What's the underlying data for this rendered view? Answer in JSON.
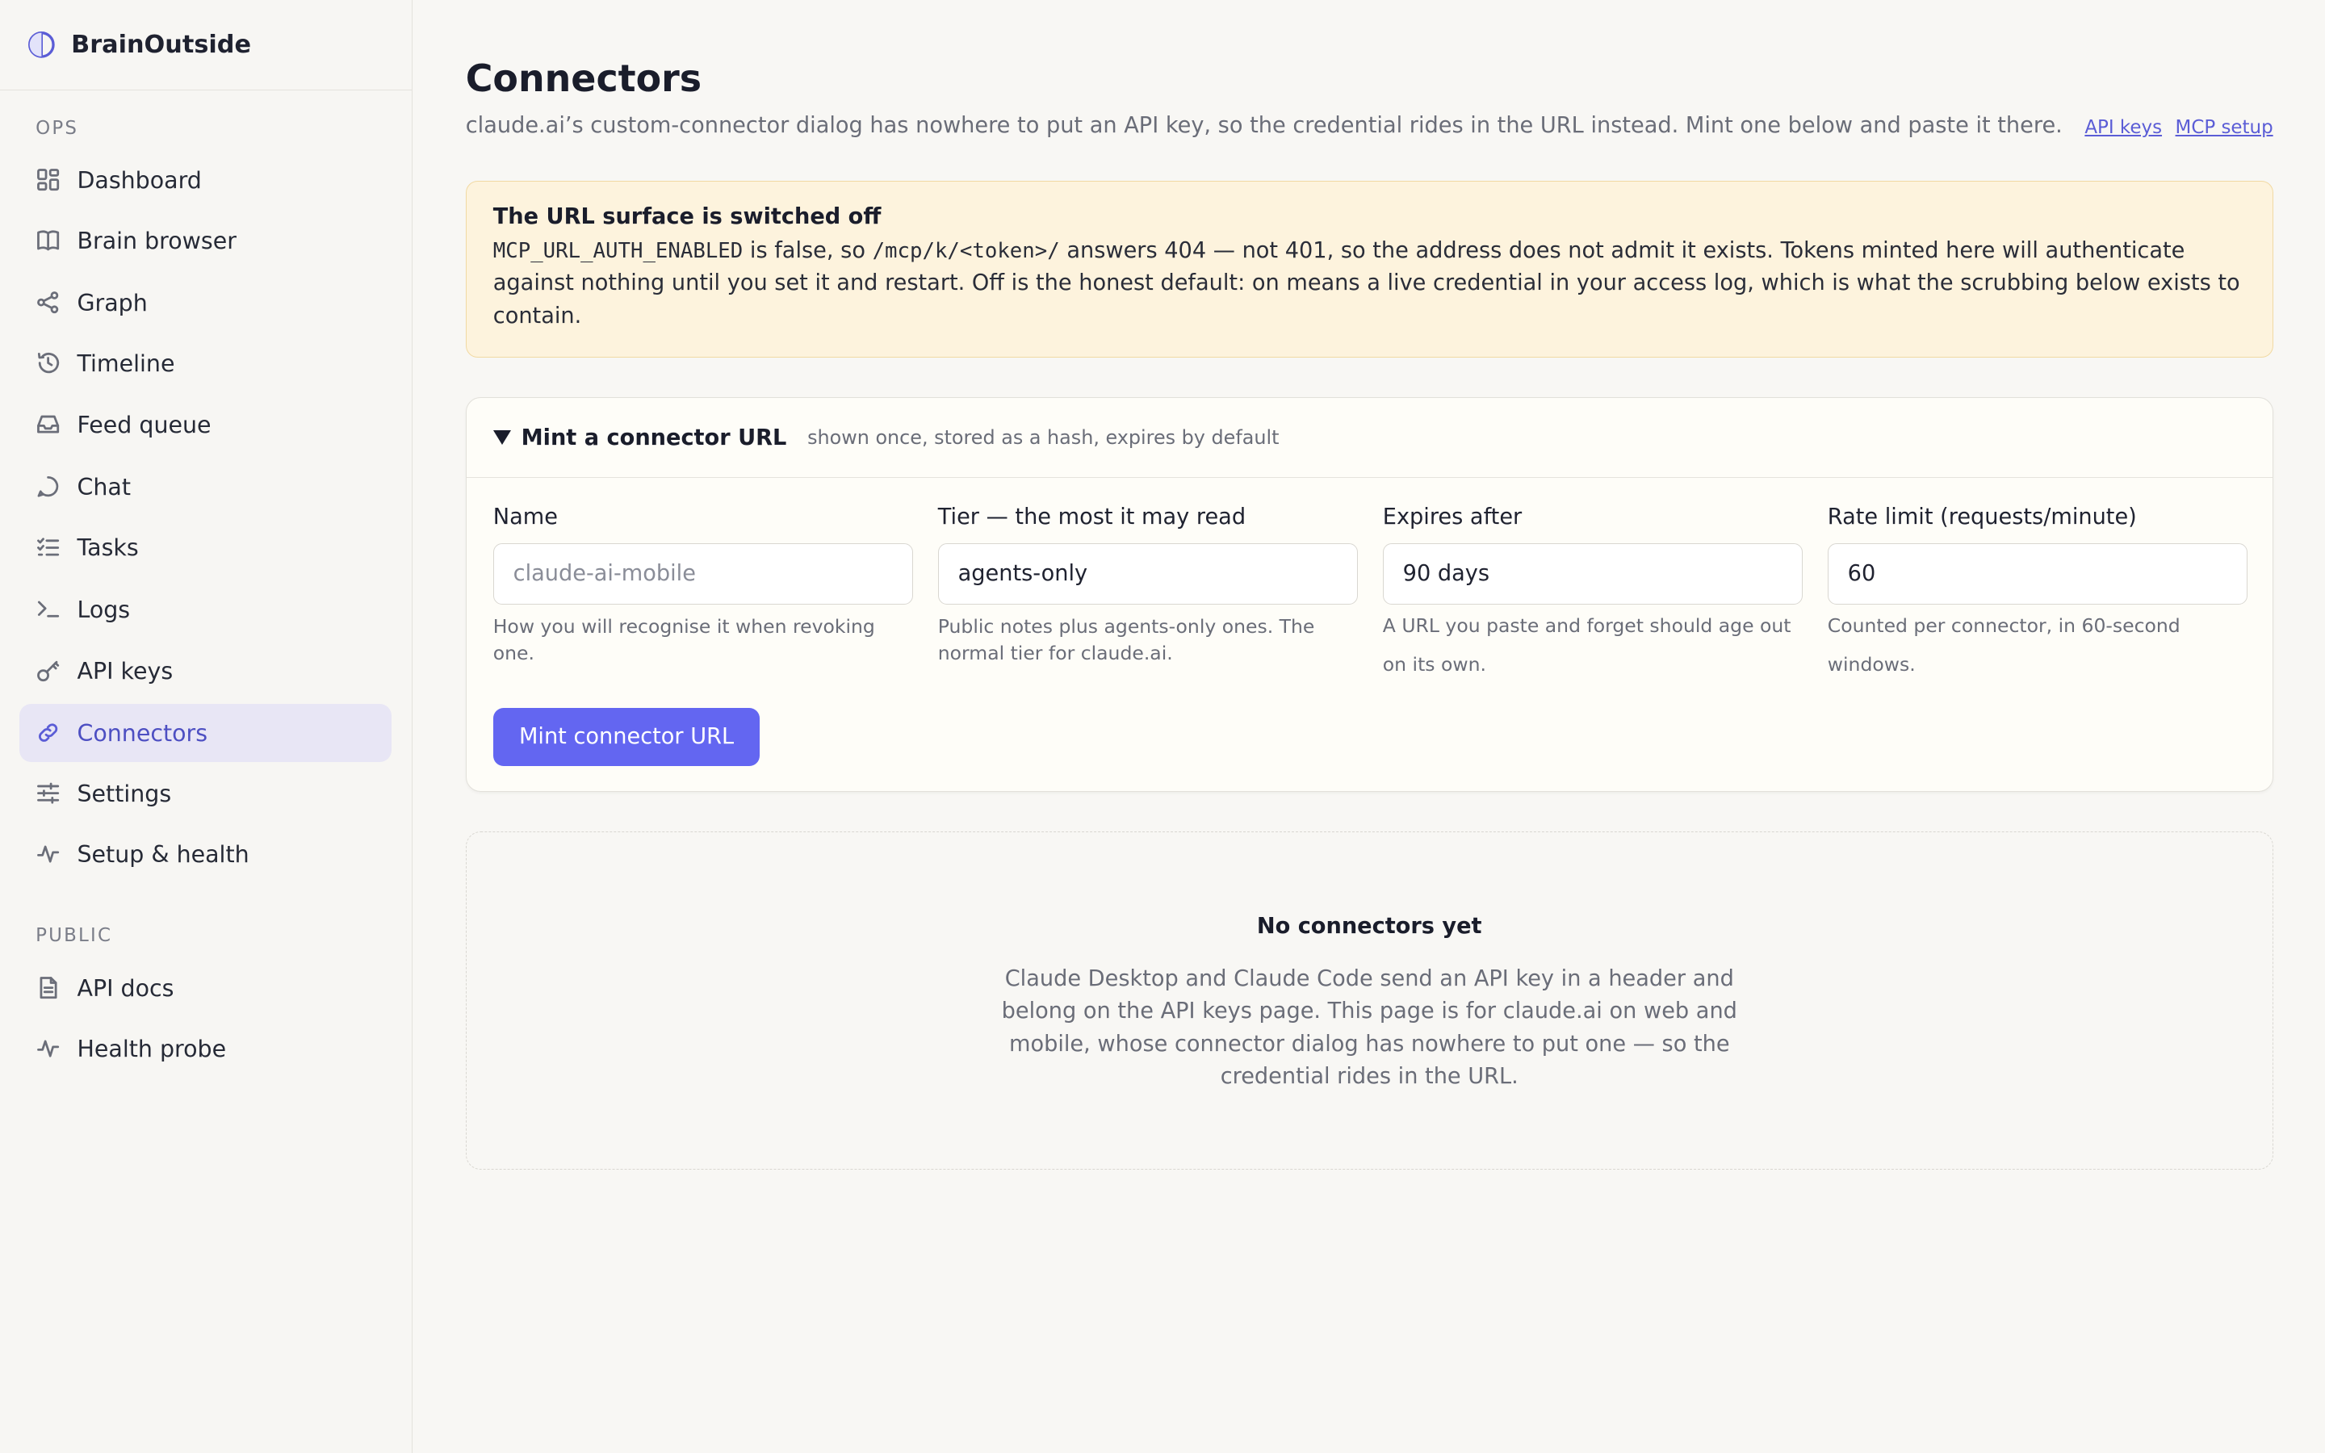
{
  "app": {
    "name": "BrainOutside"
  },
  "sidebar": {
    "sections": [
      {
        "label": "OPS"
      },
      {
        "label": "PUBLIC"
      }
    ],
    "items": [
      {
        "label": "Dashboard",
        "icon": "dashboard-icon"
      },
      {
        "label": "Brain browser",
        "icon": "book-icon"
      },
      {
        "label": "Graph",
        "icon": "share-graph-icon"
      },
      {
        "label": "Timeline",
        "icon": "history-icon"
      },
      {
        "label": "Feed queue",
        "icon": "inbox-icon"
      },
      {
        "label": "Chat",
        "icon": "chat-bubble-icon"
      },
      {
        "label": "Tasks",
        "icon": "checklist-icon"
      },
      {
        "label": "Logs",
        "icon": "terminal-icon"
      },
      {
        "label": "API keys",
        "icon": "key-icon"
      },
      {
        "label": "Connectors",
        "icon": "link-icon",
        "active": true
      },
      {
        "label": "Settings",
        "icon": "sliders-icon"
      },
      {
        "label": "Setup & health",
        "icon": "pulse-icon"
      },
      {
        "label": "API docs",
        "icon": "document-icon"
      },
      {
        "label": "Health probe",
        "icon": "pulse-icon"
      }
    ]
  },
  "header": {
    "title": "Connectors",
    "subtitle": "claude.ai’s custom-connector dialog has nowhere to put an API key, so the credential rides in the URL instead. Mint one below and paste it there.",
    "links": [
      "API keys",
      "MCP setup"
    ]
  },
  "alert": {
    "title": "The URL surface is switched off",
    "code1": "MCP_URL_AUTH_ENABLED",
    "text1": " is false, so ",
    "code2": "/mcp/k/<token>/",
    "text2": " answers 404 — not 401, so the address does not admit it exists. Tokens minted here will authenticate against nothing until you set it and restart. Off is the honest default: on means a live credential in your access log, which is what the scrubbing below exists to contain."
  },
  "mint": {
    "title": "Mint a connector URL",
    "hint": "shown once, stored as a hash, expires by default",
    "fields": {
      "name": {
        "label": "Name",
        "placeholder": "claude-ai-mobile",
        "value": "",
        "help": "How you will recognise it when revoking one."
      },
      "tier": {
        "label": "Tier — the most it may read",
        "value": "agents-only",
        "help": "Public notes plus agents-only ones. The normal tier for claude.ai."
      },
      "expires": {
        "label": "Expires after",
        "value": "90 days",
        "help": "A URL you paste and forget should age out on its own."
      },
      "rate": {
        "label": "Rate limit (requests/minute)",
        "value": "60",
        "help": "Counted per connector, in 60-second windows."
      }
    },
    "button": "Mint connector URL"
  },
  "empty": {
    "title": "No connectors yet",
    "body": "Claude Desktop and Claude Code send an API key in a header and belong on the API keys page. This page is for claude.ai on web and mobile, whose connector dialog has nowhere to put one — so the credential rides in the URL."
  },
  "colors": {
    "accent": "#6366f1",
    "alert_bg": "#fdf3dd",
    "active_nav_bg": "#e8e6f5"
  }
}
